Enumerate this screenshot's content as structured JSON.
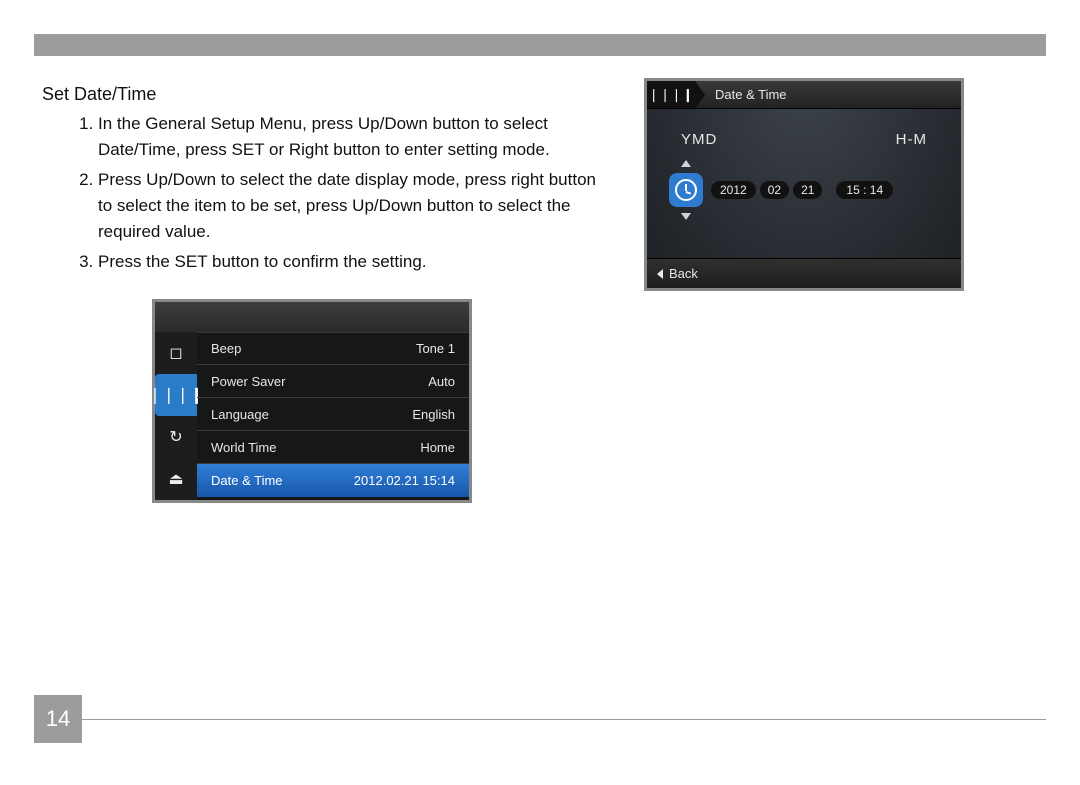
{
  "page_number": "14",
  "section_title": "Set Date/Time",
  "instructions": [
    "In the General Setup Menu, press Up/Down button to select Date/Time, press SET or Right button to enter setting mode.",
    "Press Up/Down to select the date display mode, press right button to select the item to be set, press Up/Down button to select the required value.",
    "Press the SET button to confirm the setting."
  ],
  "menu": {
    "tabs": [
      {
        "icon": "camera-icon",
        "glyph": "◻",
        "active": false
      },
      {
        "icon": "settings-icon",
        "glyph": "❘❘❘❙",
        "active": true
      },
      {
        "icon": "refresh-icon",
        "glyph": "↻",
        "active": false
      },
      {
        "icon": "connectivity-icon",
        "glyph": "⏏",
        "active": false
      }
    ],
    "items": [
      {
        "label": "Beep",
        "value": "Tone 1",
        "selected": false
      },
      {
        "label": "Power Saver",
        "value": "Auto",
        "selected": false
      },
      {
        "label": "Language",
        "value": "English",
        "selected": false
      },
      {
        "label": "World Time",
        "value": "Home",
        "selected": false
      },
      {
        "label": "Date & Time",
        "value": "2012.02.21 15:14",
        "selected": true
      }
    ]
  },
  "datetime_screen": {
    "header_icon_glyph": "❘❘❘❙",
    "title": "Date & Time",
    "format_label": "YMD",
    "time_label": "H-M",
    "year": "2012",
    "month": "02",
    "day": "21",
    "time": "15 : 14",
    "back_label": "Back"
  }
}
